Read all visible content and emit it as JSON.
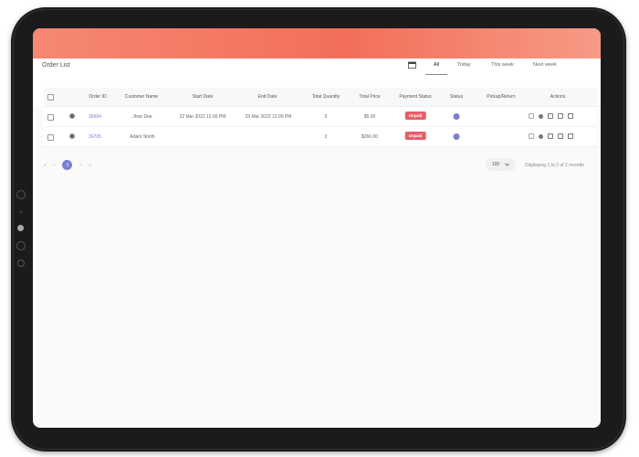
{
  "page": {
    "title": "Order List"
  },
  "tabs": [
    {
      "label": "All",
      "active": true
    },
    {
      "label": "Today",
      "active": false
    },
    {
      "label": "This week",
      "active": false
    },
    {
      "label": "Next week",
      "active": false
    }
  ],
  "table": {
    "headers": [
      "Order ID",
      "Customer Name",
      "Start Date",
      "End Date",
      "Total Quantity",
      "Total Price",
      "Payment Status",
      "Status",
      "Pickup/Return",
      "Actions"
    ],
    "rows": [
      {
        "order_id": "36694",
        "customer": "Jhon Doe",
        "start": "22 Mar 2022 12:00 PM",
        "end": "23 Mar 2022 12:00 PM",
        "qty": "5",
        "price": "$5.00",
        "payment": "Unpaid"
      },
      {
        "order_id": "36705",
        "customer": "Adam Smith",
        "start": "",
        "end": "",
        "qty": "2",
        "price": "$260.00",
        "payment": "Unpaid"
      }
    ]
  },
  "pagination": {
    "first": "«",
    "prev": "‹",
    "current": "1",
    "next": "›",
    "last": "»",
    "per_page": "100",
    "records": "Displaying 1 to 2 of 2 records"
  },
  "colors": {
    "header": "#f26f5a",
    "accent": "#7b7fd0",
    "badge": "#e55f6a"
  }
}
